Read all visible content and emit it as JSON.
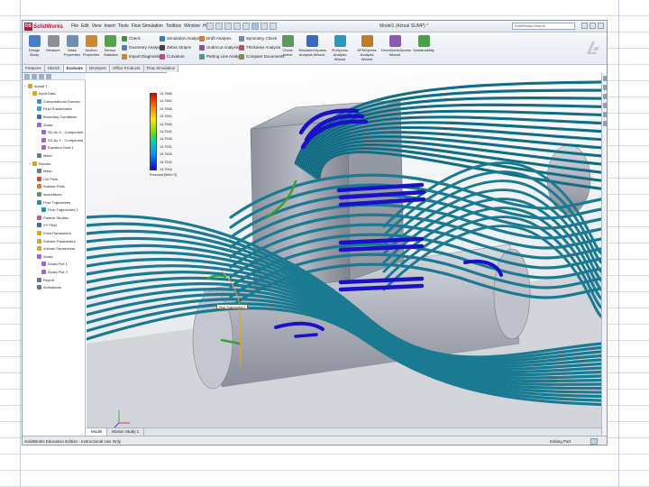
{
  "app": {
    "brand": "SolidWorks",
    "menu": [
      "File",
      "Edit",
      "View",
      "Insert",
      "Tools",
      "Flow Simulation",
      "Toolbox",
      "Window",
      "Help"
    ],
    "document_title": "Model1 (Actual SUMP) *",
    "search_placeholder": "SolidWorks Search"
  },
  "ribbon": {
    "big_buttons": [
      {
        "label": "Design Study",
        "icon": "design-study-icon",
        "color": "#4a7fc1"
      },
      {
        "label": "Measure",
        "icon": "measure-icon",
        "color": "#8a8f99"
      },
      {
        "label": "Mass Properties",
        "icon": "mass-properties-icon",
        "color": "#6e8fb0"
      },
      {
        "label": "Section Properties",
        "icon": "section-properties-icon",
        "color": "#c98a2b"
      },
      {
        "label": "Sensor",
        "icon": "sensor-icon",
        "color": "#5b9e4d"
      },
      {
        "label": "Statistics",
        "icon": "statistics-icon",
        "color": "#7d7d9a"
      }
    ],
    "col1": [
      "Check",
      "Geometry Analysis",
      "Import Diagnostics"
    ],
    "col2": [
      "Simulation Analysis",
      "Draft Analysis",
      "Zebra Stripes",
      "Curvature"
    ],
    "col3": [
      "Undercut Analysis",
      "Parting Line Analysis"
    ],
    "col4": [
      "Symmetry Check",
      "Thickness Analysis",
      "Compare Documents"
    ],
    "check_active": "Check Active",
    "right_buttons": [
      "SimulationXpress Analysis Wizard",
      "FloXpress Analysis Wizard",
      "DFMXpress Analysis Wizard",
      "DriveWorksXpress Wizard",
      "Sustainability"
    ]
  },
  "tabs": [
    "Features",
    "Sketch",
    "Evaluate",
    "DimXpert",
    "Office Products",
    "Flow Simulation"
  ],
  "active_tab": "Evaluate",
  "tree": {
    "items": [
      {
        "label": "Actual T",
        "level": 0,
        "icon": "part-icon",
        "color": "#e0a020"
      },
      {
        "label": "Input Data",
        "level": 1,
        "icon": "folder-icon",
        "color": "#d9a41e"
      },
      {
        "label": "Computational Domain",
        "level": 2,
        "icon": "domain-icon",
        "color": "#4a8ad0"
      },
      {
        "label": "Fluid Subdomains",
        "level": 2,
        "icon": "fluid-icon",
        "color": "#3aa0e0"
      },
      {
        "label": "Boundary Conditions",
        "level": 2,
        "icon": "boundary-icon",
        "color": "#2a74c4"
      },
      {
        "label": "Goals",
        "level": 2,
        "icon": "goals-icon",
        "color": "#9a6bc6"
      },
      {
        "label": "SG Av X - Component",
        "level": 3,
        "icon": "goal-icon",
        "color": "#9a6bc6"
      },
      {
        "label": "SG Av Y - Component",
        "level": 3,
        "icon": "goal-icon",
        "color": "#9a6bc6"
      },
      {
        "label": "Equation Goal 1",
        "level": 3,
        "icon": "goal-icon",
        "color": "#9a6bc6"
      },
      {
        "label": "Mesh",
        "level": 2,
        "icon": "mesh-icon",
        "color": "#6a7a8c"
      },
      {
        "label": "Results",
        "level": 1,
        "icon": "folder-icon",
        "color": "#d9a41e"
      },
      {
        "label": "Mesh",
        "level": 2,
        "icon": "mesh-icon",
        "color": "#6a7a8c"
      },
      {
        "label": "Cut Plots",
        "level": 2,
        "icon": "cut-plot-icon",
        "color": "#d04a3a"
      },
      {
        "label": "Surface Plots",
        "level": 2,
        "icon": "surface-plot-icon",
        "color": "#e07a2a"
      },
      {
        "label": "Isosurfaces",
        "level": 2,
        "icon": "isosurface-icon",
        "color": "#4aa050"
      },
      {
        "label": "Flow Trajectories",
        "level": 2,
        "icon": "trajectory-icon",
        "color": "#2a8ab0"
      },
      {
        "label": "Flow Trajectories 2",
        "level": 3,
        "icon": "trajectory-icon",
        "color": "#2a8ab0"
      },
      {
        "label": "Particle Studies",
        "level": 2,
        "icon": "particle-icon",
        "color": "#c05a9a"
      },
      {
        "label": "XY Plots",
        "level": 2,
        "icon": "xy-plot-icon",
        "color": "#3a6ac0"
      },
      {
        "label": "Point Parameters",
        "level": 2,
        "icon": "point-param-icon",
        "color": "#e0a020"
      },
      {
        "label": "Surface Parameters",
        "level": 2,
        "icon": "surface-param-icon",
        "color": "#e0a020"
      },
      {
        "label": "Volume Parameters",
        "level": 2,
        "icon": "volume-param-icon",
        "color": "#e0a020"
      },
      {
        "label": "Goals",
        "level": 2,
        "icon": "goals-icon",
        "color": "#9a6bc6"
      },
      {
        "label": "Goals Plot 1",
        "level": 3,
        "icon": "goal-plot-icon",
        "color": "#9a6bc6"
      },
      {
        "label": "Goals Plot 2",
        "level": 3,
        "icon": "goal-plot-icon",
        "color": "#9a6bc6"
      },
      {
        "label": "Report",
        "level": 2,
        "icon": "report-icon",
        "color": "#5a7a9a"
      },
      {
        "label": "Animations",
        "level": 2,
        "icon": "animation-icon",
        "color": "#5a7a9a"
      }
    ]
  },
  "legend": {
    "values": [
      "14.7566",
      "14.7561",
      "14.7556",
      "14.7551",
      "14.7546",
      "14.7541",
      "14.7536",
      "14.7531",
      "14.7526",
      "14.7521",
      "14.7516"
    ],
    "unit": "Pressure [lbf/in^2]"
  },
  "probe_label": "Flow Trajectories 2",
  "model_tabs": [
    "Model",
    "Motion Study 1"
  ],
  "status": {
    "left": "SolidWorks Education Edition - Instructional Use Only",
    "right": "Editing Part"
  },
  "colors": {
    "streamline": "#1a7a92",
    "streamline_dark": "#0c4f63",
    "low_pressure": "#1a10c8",
    "mid_pressure": "#3aa030",
    "part_gray": "#a6a9b3"
  }
}
